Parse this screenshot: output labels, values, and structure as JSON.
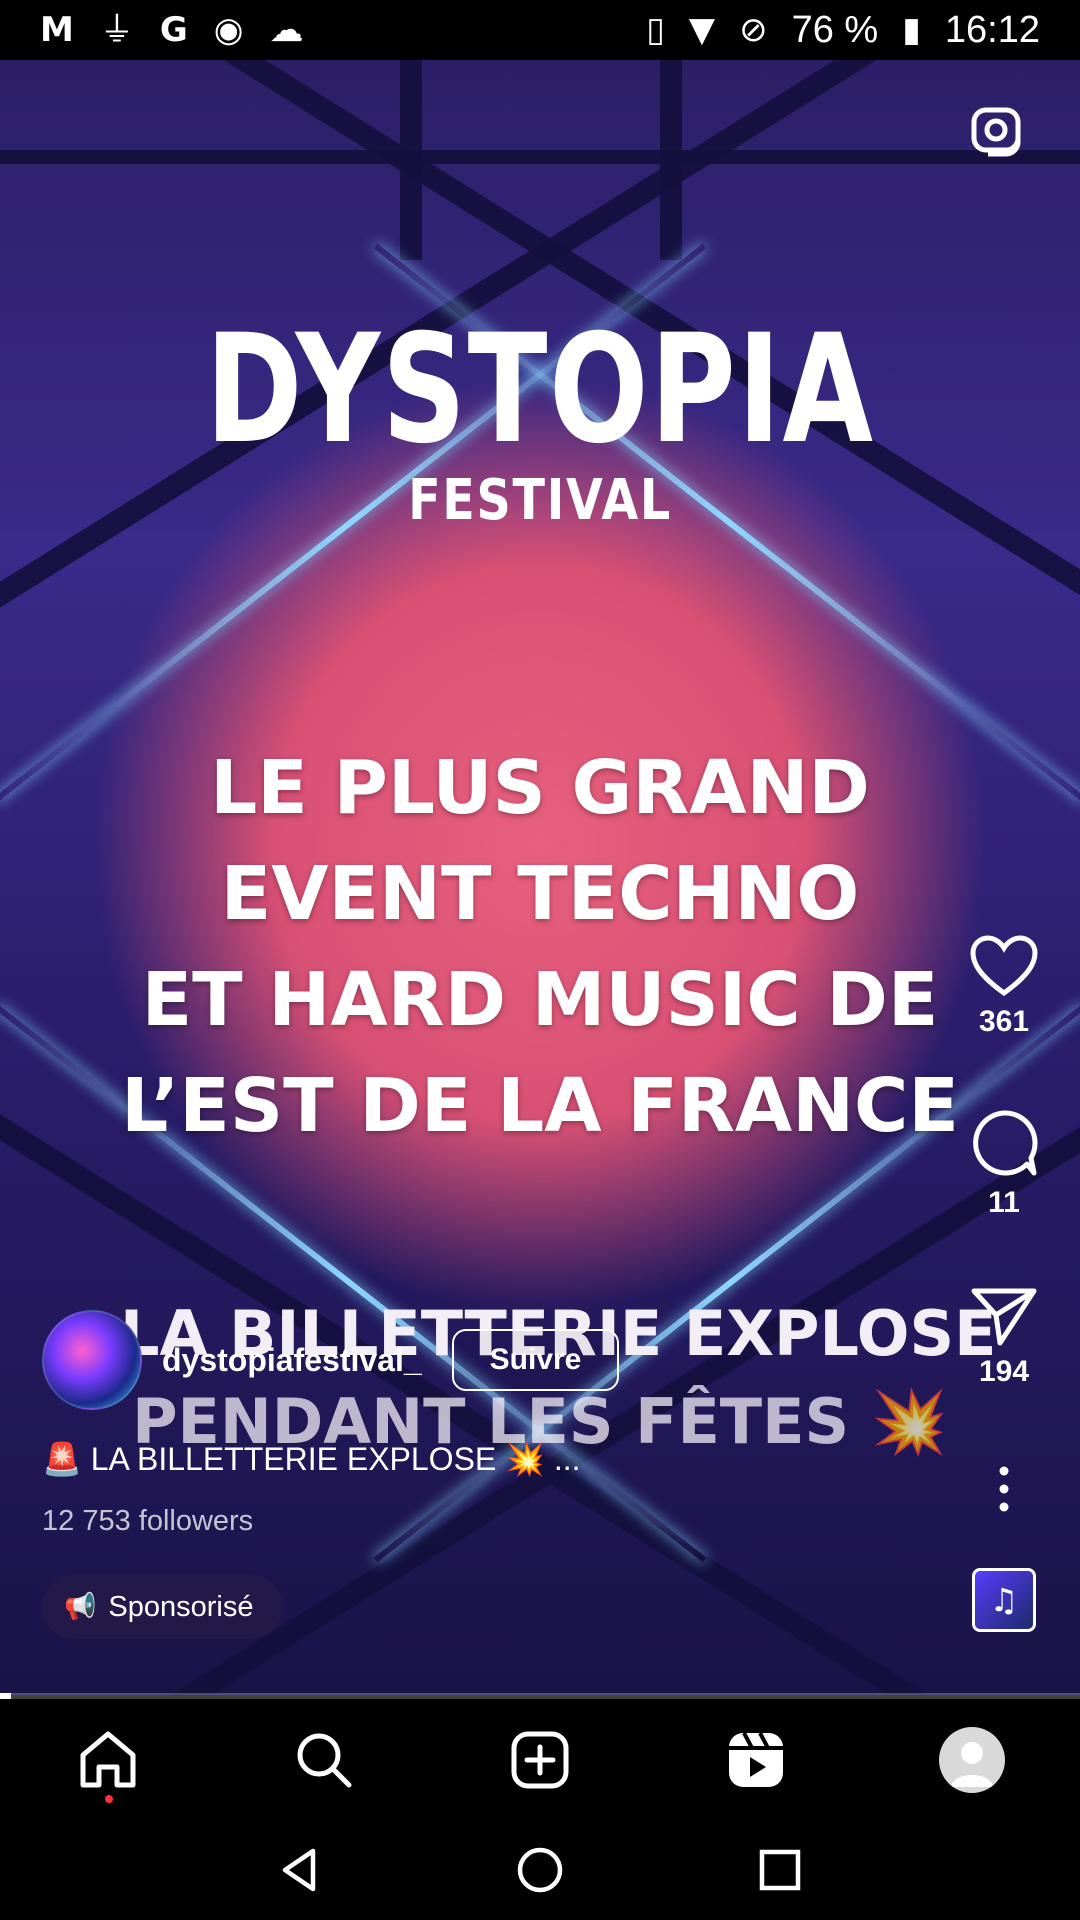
{
  "status_bar": {
    "battery": "76 %",
    "time": "16:12",
    "left_icons": [
      "gmail-icon",
      "usb-icon",
      "google-icon",
      "app-icon",
      "cloud-icon"
    ],
    "right_icons": [
      "vibrate-icon",
      "wifi-icon",
      "no-sim-icon",
      "battery-charging-icon"
    ]
  },
  "reel": {
    "logo_title": "DYSTOPIA",
    "logo_subtitle": "FESTIVAL",
    "headline_lines": [
      "LE PLUS GRAND",
      "EVENT TECHNO",
      "ET HARD MUSIC DE",
      "L’EST DE LA FRANCE"
    ],
    "subline_lines": [
      "LA BILLETTERIE EXPLOSE",
      "PENDANT LES FÊTES 💥"
    ],
    "progress": 0.01
  },
  "actions": {
    "likes": "361",
    "comments": "11",
    "shares": "194"
  },
  "author": {
    "username": "dystopiafestival_",
    "follow_label": "Suivre",
    "caption": "🚨 LA BILLETTERIE EXPLOSE 💥 ...",
    "followers": "12 753 followers",
    "sponsored_label": "Sponsorisé"
  },
  "colors": {
    "notification_dot": "#ff3040",
    "background": "#000000"
  }
}
